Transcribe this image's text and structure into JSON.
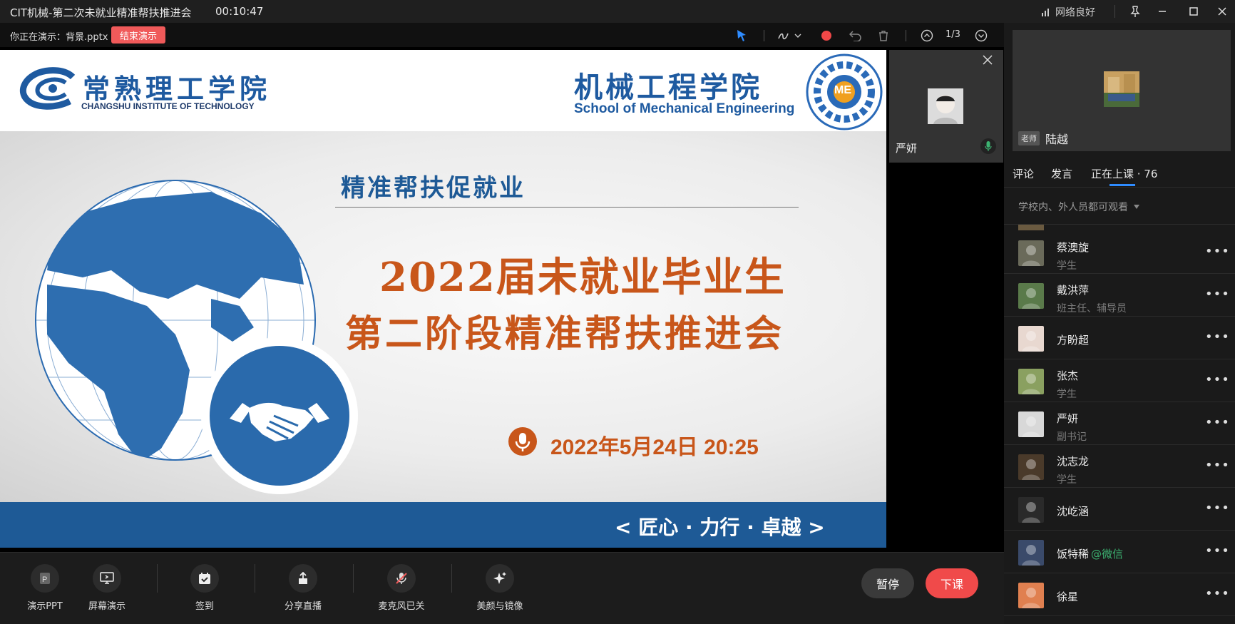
{
  "window": {
    "title": "CIT机械-第二次未就业精准帮扶推进会",
    "timer": "00:10:47",
    "network": "网络良好"
  },
  "present_bar": {
    "status_label": "你正在演示：背景.pptx",
    "end_button": "结束演示",
    "page_indicator": "1/3"
  },
  "slide": {
    "school_name_cn": "常熟理工学院",
    "school_name_en": "CHANGSHU INSTITUTE OF TECHNOLOGY",
    "college_name_cn": "机械工程学院",
    "college_name_en": "School of Mechanical Engineering",
    "seal_center_text": "ME",
    "subtitle": "精准帮扶促就业",
    "title_line1": "2022届未就业毕业生",
    "title_line2": "第二阶段精准帮扶推进会",
    "datetime": "2022年5月24日 20:25",
    "motto": "< 匠心 · 力行 · 卓越 >"
  },
  "cameo": {
    "name": "严妍"
  },
  "teacher": {
    "badge": "老师",
    "name": "陆越"
  },
  "tabs": {
    "comments": "评论",
    "speak": "发言",
    "in_class": "正在上课 · 76"
  },
  "visibility": "学校内、外人员都可观看",
  "members": [
    {
      "name": "蔡澳旋",
      "role": "学生",
      "color": "#6a6a5a"
    },
    {
      "name": "戴洪萍",
      "role": "班主任、辅导员",
      "color": "#5a7a4a"
    },
    {
      "name": "方盼超",
      "role": "",
      "color": "#e8d8d0"
    },
    {
      "name": "张杰",
      "role": "学生",
      "color": "#8aa060"
    },
    {
      "name": "严妍",
      "role": "副书记",
      "color": "#d8d8d8"
    },
    {
      "name": "沈志龙",
      "role": "学生",
      "color": "#4a3a2a"
    },
    {
      "name": "沈屹涵",
      "role": "",
      "color": "#2a2a2a"
    },
    {
      "name": "饭特稀",
      "role": "",
      "suffix": "@微信",
      "color": "#3a4a6a"
    },
    {
      "name": "徐星",
      "role": "",
      "color": "#e08050"
    }
  ],
  "bottom_bar": {
    "ppt": "演示PPT",
    "screen": "屏幕演示",
    "checkin": "签到",
    "share": "分享直播",
    "mic": "麦克风已关",
    "beauty": "美颜与镜像",
    "pause": "暂停",
    "end_class": "下课"
  },
  "colors": {
    "accent_red": "#f05a5a",
    "slide_blue": "#1e5a96",
    "slide_orange": "#c8561a",
    "wechat_green": "#3cb371"
  }
}
